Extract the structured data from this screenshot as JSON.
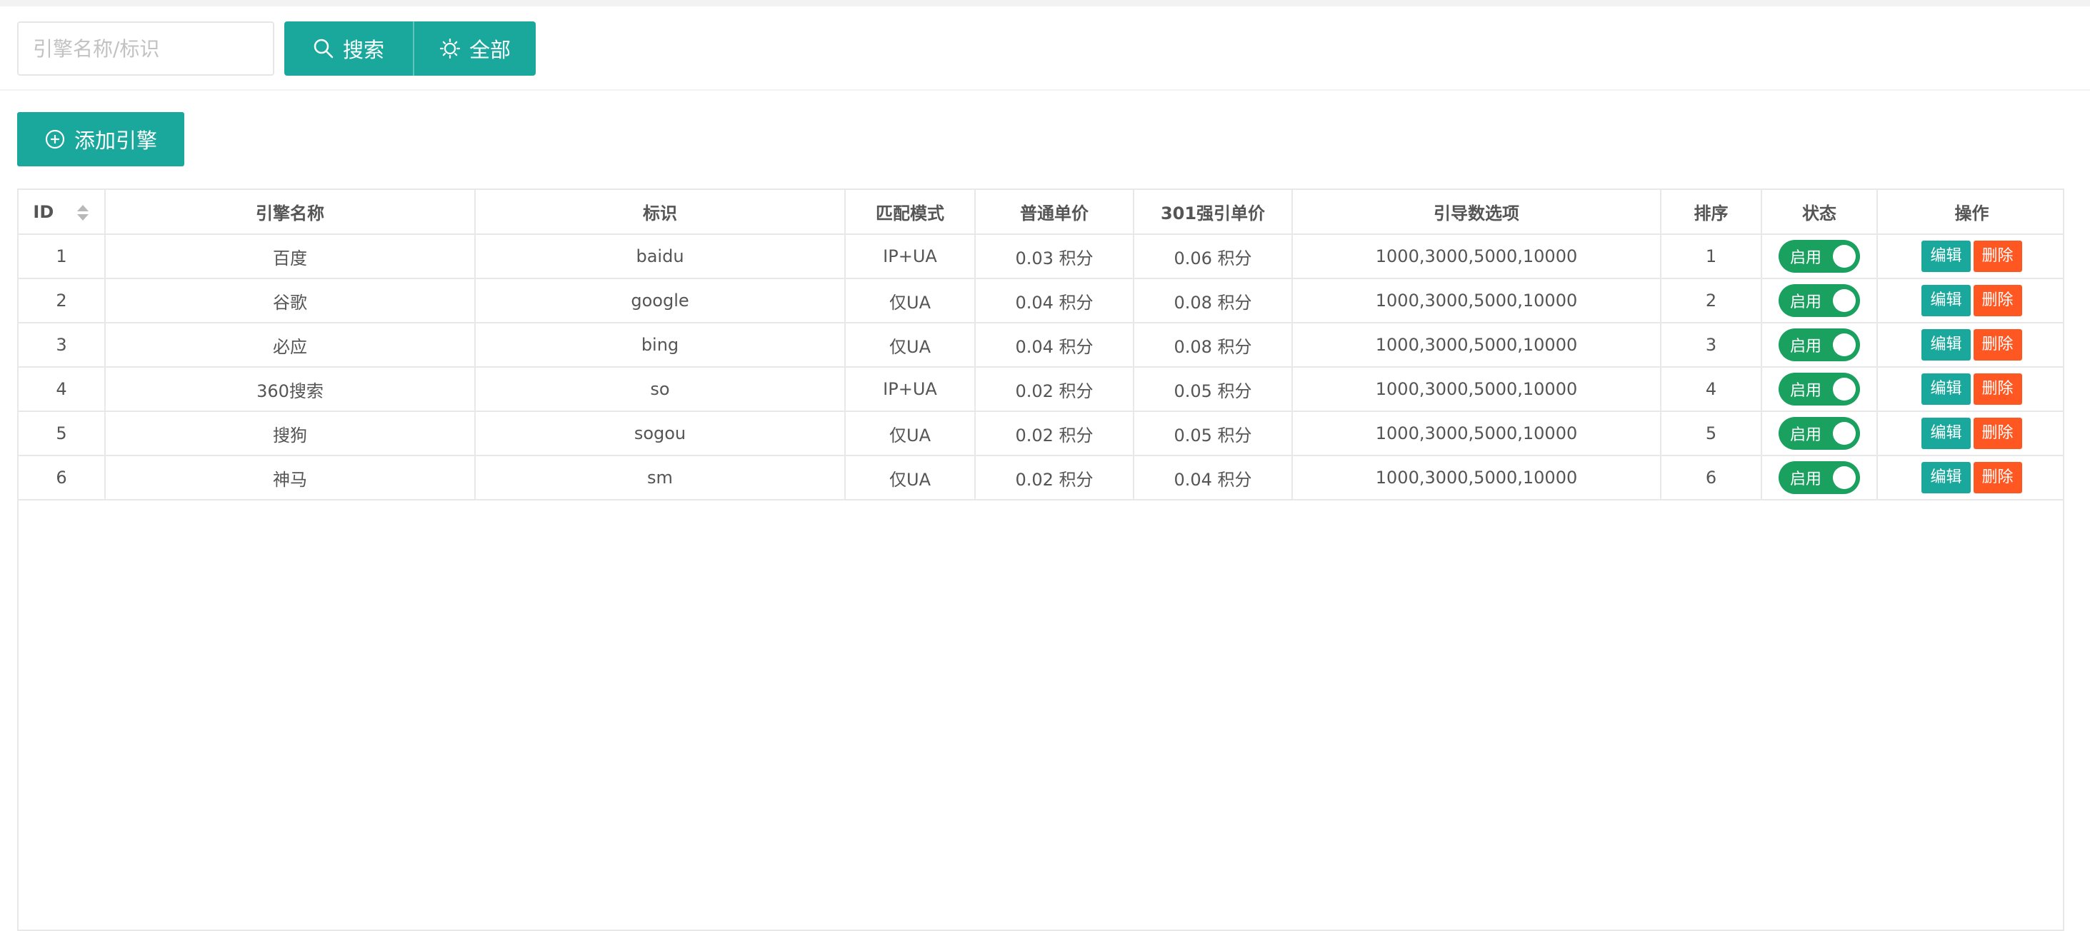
{
  "search": {
    "placeholder": "引擎名称/标识",
    "value": "",
    "search_label": "搜索",
    "all_label": "全部"
  },
  "toolbar": {
    "add_label": "添加引擎"
  },
  "colors": {
    "primary": "#1aa89d",
    "switch_on": "#1aa160",
    "danger": "#ff5722"
  },
  "table": {
    "headers": [
      "ID",
      "引擎名称",
      "标识",
      "匹配模式",
      "普通单价",
      "301强引单价",
      "引导数选项",
      "排序",
      "状态",
      "操作"
    ],
    "rows": [
      {
        "id": "1",
        "name": "百度",
        "key": "baidu",
        "mode": "IP+UA",
        "price": "0.03 积分",
        "price301": "0.06 积分",
        "options": "1000,3000,5000,10000",
        "sort": "1",
        "status": "启用",
        "edit": "编辑",
        "delete": "删除"
      },
      {
        "id": "2",
        "name": "谷歌",
        "key": "google",
        "mode": "仅UA",
        "price": "0.04 积分",
        "price301": "0.08 积分",
        "options": "1000,3000,5000,10000",
        "sort": "2",
        "status": "启用",
        "edit": "编辑",
        "delete": "删除"
      },
      {
        "id": "3",
        "name": "必应",
        "key": "bing",
        "mode": "仅UA",
        "price": "0.04 积分",
        "price301": "0.08 积分",
        "options": "1000,3000,5000,10000",
        "sort": "3",
        "status": "启用",
        "edit": "编辑",
        "delete": "删除"
      },
      {
        "id": "4",
        "name": "360搜索",
        "key": "so",
        "mode": "IP+UA",
        "price": "0.02 积分",
        "price301": "0.05 积分",
        "options": "1000,3000,5000,10000",
        "sort": "4",
        "status": "启用",
        "edit": "编辑",
        "delete": "删除"
      },
      {
        "id": "5",
        "name": "搜狗",
        "key": "sogou",
        "mode": "仅UA",
        "price": "0.02 积分",
        "price301": "0.05 积分",
        "options": "1000,3000,5000,10000",
        "sort": "5",
        "status": "启用",
        "edit": "编辑",
        "delete": "删除"
      },
      {
        "id": "6",
        "name": "神马",
        "key": "sm",
        "mode": "仅UA",
        "price": "0.02 积分",
        "price301": "0.04 积分",
        "options": "1000,3000,5000,10000",
        "sort": "6",
        "status": "启用",
        "edit": "编辑",
        "delete": "删除"
      }
    ]
  }
}
